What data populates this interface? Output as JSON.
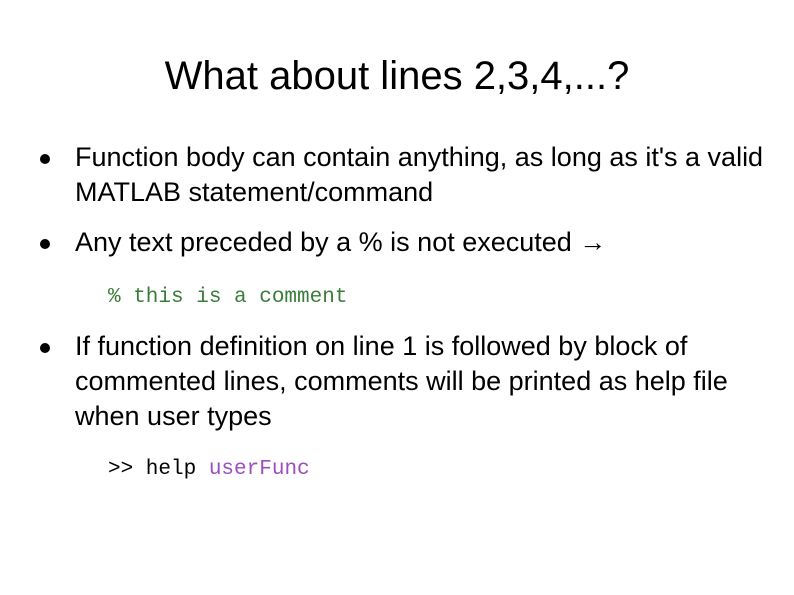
{
  "slide": {
    "title": "What about lines 2,3,4,...?",
    "bullets": [
      {
        "text": "Function body can contain anything, as long as it's a valid MATLAB statement/command"
      },
      {
        "text": "Any text preceded by a % is not executed →"
      },
      {
        "text": "If function definition on line 1 is followed by block of commented lines, comments will be printed as help file when user types"
      }
    ],
    "comment_example": "% this is a comment",
    "help_command": {
      "prompt": ">> help ",
      "argument": "userFunc"
    }
  }
}
